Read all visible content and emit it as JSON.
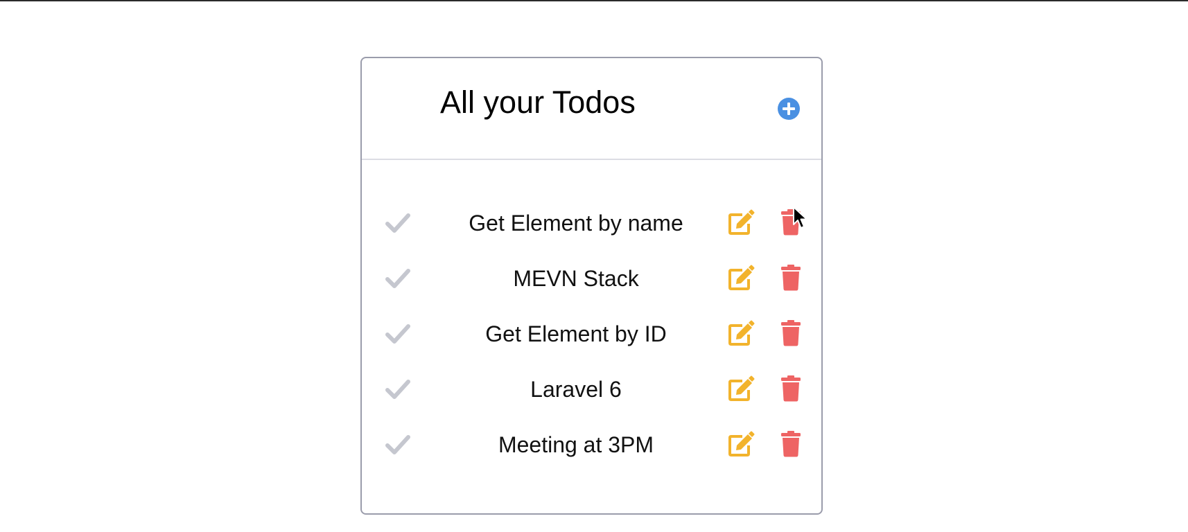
{
  "header": {
    "title": "All your Todos",
    "add_icon": "plus-circle-icon"
  },
  "todos": [
    {
      "text": "Get Element by name",
      "completed": false
    },
    {
      "text": "MEVN Stack",
      "completed": false
    },
    {
      "text": "Get Element by ID",
      "completed": false
    },
    {
      "text": "Laravel 6",
      "completed": false
    },
    {
      "text": "Meeting at 3PM",
      "completed": false
    }
  ],
  "icons": {
    "check": "check-icon",
    "edit": "edit-icon",
    "delete": "trash-icon"
  },
  "colors": {
    "accent_blue": "#4a90e2",
    "edit_yellow": "#f2b32c",
    "delete_red": "#ee6464",
    "check_gray": "#c5c7cf",
    "card_border": "#9a9cab",
    "divider": "#dcdde3"
  }
}
